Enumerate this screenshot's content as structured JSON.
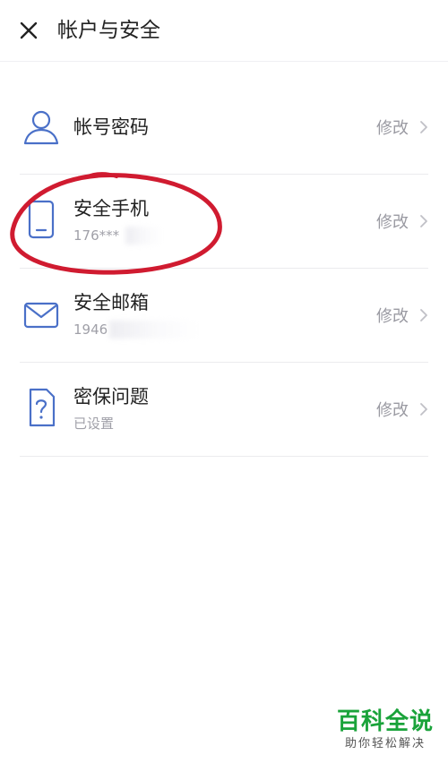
{
  "header": {
    "title": "帐户与安全",
    "close_icon": "close-icon"
  },
  "rows": [
    {
      "icon": "user-icon",
      "title": "帐号密码",
      "subtitle": "",
      "action": "修改"
    },
    {
      "icon": "phone-icon",
      "title": "安全手机",
      "subtitle": "176***",
      "action": "修改"
    },
    {
      "icon": "mail-icon",
      "title": "安全邮箱",
      "subtitle": "1946",
      "action": "修改"
    },
    {
      "icon": "question-doc-icon",
      "title": "密保问题",
      "subtitle": "已设置",
      "action": "修改"
    }
  ],
  "colors": {
    "icon_blue": "#4a70c8",
    "annotation_red": "#d01b30",
    "watermark_green": "#1aa33a"
  },
  "watermark": {
    "title": "百科全说",
    "subtitle": "助你轻松解决"
  }
}
